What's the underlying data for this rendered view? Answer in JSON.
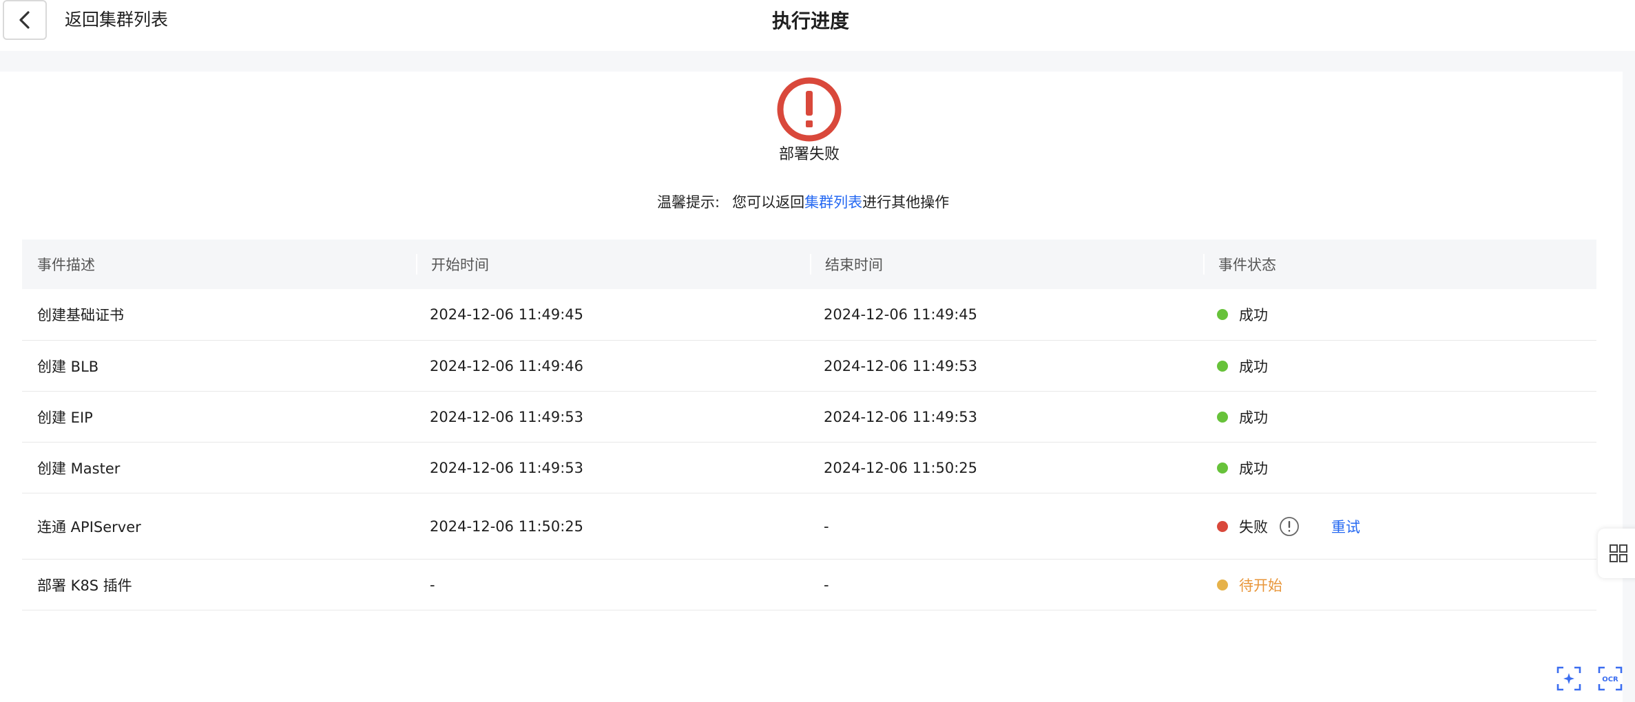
{
  "header": {
    "back_label": "返回集群列表",
    "title": "执行进度"
  },
  "status": {
    "text": "部署失败",
    "color": "#d9483b"
  },
  "tip": {
    "prefix": "温馨提示:",
    "before_link": "您可以返回",
    "link": "集群列表",
    "after_link": "进行其他操作"
  },
  "table": {
    "columns": [
      "事件描述",
      "开始时间",
      "结束时间",
      "事件状态"
    ],
    "rows": [
      {
        "desc": "创建基础证书",
        "start": "2024-12-06 11:49:45",
        "end": "2024-12-06 11:49:45",
        "status": "成功"
      },
      {
        "desc": "创建 BLB",
        "start": "2024-12-06 11:49:46",
        "end": "2024-12-06 11:49:53",
        "status": "成功"
      },
      {
        "desc": "创建 EIP",
        "start": "2024-12-06 11:49:53",
        "end": "2024-12-06 11:49:53",
        "status": "成功"
      },
      {
        "desc": "创建 Master",
        "start": "2024-12-06 11:49:53",
        "end": "2024-12-06 11:50:25",
        "status": "成功"
      },
      {
        "desc": "连通 APIServer",
        "start": "2024-12-06 11:50:25",
        "end": "-",
        "status": "失败",
        "action": "重试"
      },
      {
        "desc": "部署 K8S 插件",
        "start": "-",
        "end": "-",
        "status": "待开始"
      }
    ]
  },
  "colors": {
    "success": "#67c23a",
    "failed": "#d9483b",
    "pending": "#e6b24a",
    "pending_text": "#e8963a",
    "link": "#2468f2"
  },
  "icons": {
    "back": "chevron-left-icon",
    "status": "exclamation-circle-icon",
    "info": "info-circle-icon",
    "side": "grid-icon",
    "ai": "ai-scan-icon",
    "ocr": "ocr-icon"
  },
  "widgets": {
    "ocr_label": "OCR"
  }
}
